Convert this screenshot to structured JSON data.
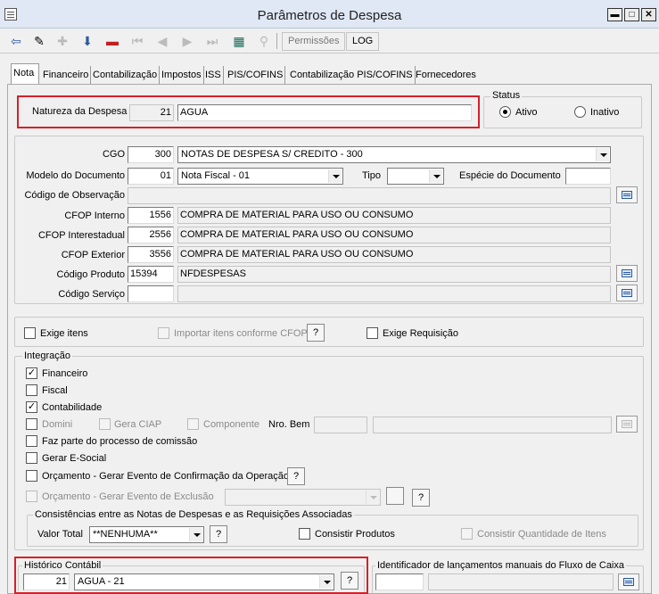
{
  "window": {
    "title": "Parâmetros de Despesa",
    "min": "▬",
    "max": "□",
    "close": "✕"
  },
  "toolbar": {
    "permissoes": "Permissões",
    "log": "LOG"
  },
  "tabs": [
    "Nota",
    "Financeiro",
    "Contabilização",
    "Impostos",
    "ISS",
    "PIS/COFINS",
    "Contabilização PIS/COFINS",
    "Fornecedores"
  ],
  "natureza": {
    "label": "Natureza da Despesa",
    "code": "21",
    "desc": "AGUA"
  },
  "status": {
    "title": "Status",
    "ativo": "Ativo",
    "inativo": "Inativo",
    "selected": "Ativo"
  },
  "cgo": {
    "label": "CGO",
    "code": "300",
    "desc": "NOTAS DE DESPESA S/ CREDITO - 300"
  },
  "modelo": {
    "label": "Modelo do Documento",
    "code": "01",
    "desc": "Nota Fiscal - 01"
  },
  "tipo": {
    "label": "Tipo",
    "value": ""
  },
  "especie": {
    "label": "Espécie do Documento",
    "value": ""
  },
  "observacao": {
    "label": "Código de Observação",
    "value": ""
  },
  "cfop_interno": {
    "label": "CFOP Interno",
    "code": "1556",
    "desc": "COMPRA DE MATERIAL PARA USO OU CONSUMO"
  },
  "cfop_interestadual": {
    "label": "CFOP Interestadual",
    "code": "2556",
    "desc": "COMPRA DE MATERIAL PARA USO OU CONSUMO"
  },
  "cfop_exterior": {
    "label": "CFOP Exterior",
    "code": "3556",
    "desc": "COMPRA DE MATERIAL PARA USO OU CONSUMO"
  },
  "produto": {
    "label": "Código Produto",
    "code": "15394",
    "desc": "NFDESPESAS"
  },
  "servico": {
    "label": "Código Serviço",
    "code": "",
    "desc": ""
  },
  "opcoes": {
    "exige_itens": "Exige itens",
    "importar_itens": "Importar itens conforme CFOP",
    "exige_requisicao": "Exige Requisição",
    "help": "?"
  },
  "integracao": {
    "title": "Integração",
    "financeiro": "Financeiro",
    "fiscal": "Fiscal",
    "contabilidade": "Contabilidade",
    "domini": "Domini",
    "gera_ciap": "Gera CIAP",
    "componente": "Componente",
    "nro_bem": "Nro. Bem",
    "comissao": "Faz parte do processo de comissão",
    "esocial": "Gerar E-Social",
    "orc_confirmacao": "Orçamento - Gerar Evento de Confirmação da Operação",
    "orc_exclusao": "Orçamento - Gerar Evento de Exclusão",
    "checked": {
      "financeiro": true,
      "fiscal": false,
      "contabilidade": true
    }
  },
  "consistencias": {
    "title": "Consistências entre as Notas de Despesas e as Requisições Associadas",
    "valor_total_label": "Valor Total",
    "valor_total": "**NENHUMA**",
    "consistir_produtos": "Consistir Produtos",
    "consistir_qtd": "Consistir Quantidade de Itens"
  },
  "historico": {
    "title": "Histórico Contábil",
    "code": "21",
    "desc": "AGUA - 21"
  },
  "fluxo": {
    "title": "Identificador de lançamentos manuais do Fluxo de Caixa"
  },
  "colors": {
    "highlight": "#d81f2a",
    "titlebar": "#dfe8f4"
  }
}
